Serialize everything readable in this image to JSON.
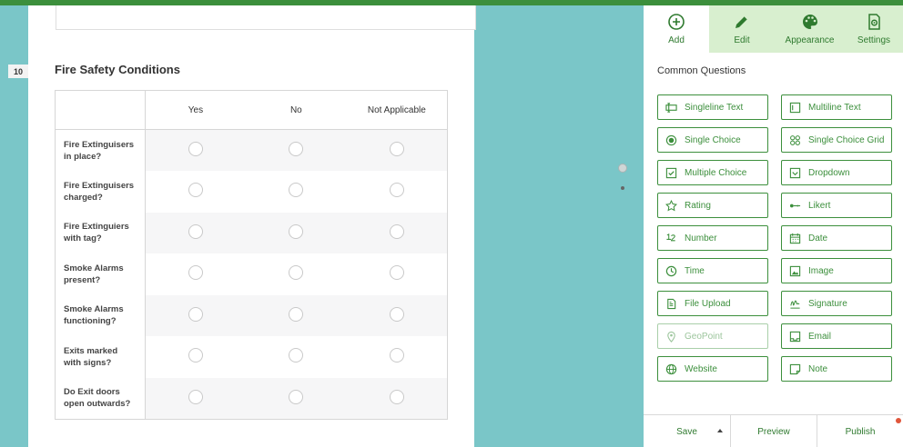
{
  "question": {
    "number": "10",
    "title": "Fire Safety Conditions",
    "columns": [
      "Yes",
      "No",
      "Not Applicable"
    ],
    "rows": [
      [
        "Fire Extinguisers",
        "in place?"
      ],
      [
        "Fire Extinguisers",
        "charged?"
      ],
      [
        "Fire Extinguiers",
        "with tag?"
      ],
      [
        "Smoke Alarms",
        "present?"
      ],
      [
        "Smoke Alarms",
        "functioning?"
      ],
      [
        "Exits marked",
        "with signs?"
      ],
      [
        "Do Exit doors",
        "open outwards?"
      ]
    ]
  },
  "panel": {
    "tabs": [
      "Add",
      "Edit",
      "Appearance",
      "Settings"
    ],
    "section_title": "Common Questions",
    "items": [
      {
        "label": "Singleline Text",
        "icon": "singleline-text-icon"
      },
      {
        "label": "Multiline Text",
        "icon": "multiline-text-icon"
      },
      {
        "label": "Single Choice",
        "icon": "radio-icon"
      },
      {
        "label": "Single Choice Grid",
        "icon": "grid-icon"
      },
      {
        "label": "Multiple Choice",
        "icon": "checkbox-icon"
      },
      {
        "label": "Dropdown",
        "icon": "dropdown-icon"
      },
      {
        "label": "Rating",
        "icon": "star-icon"
      },
      {
        "label": "Likert",
        "icon": "likert-icon"
      },
      {
        "label": "Number",
        "icon": "number-icon"
      },
      {
        "label": "Date",
        "icon": "calendar-icon"
      },
      {
        "label": "Time",
        "icon": "clock-icon"
      },
      {
        "label": "Image",
        "icon": "image-icon"
      },
      {
        "label": "File Upload",
        "icon": "file-upload-icon"
      },
      {
        "label": "Signature",
        "icon": "signature-icon"
      },
      {
        "label": "GeoPoint",
        "icon": "location-pin-icon"
      },
      {
        "label": "Email",
        "icon": "email-icon"
      },
      {
        "label": "Website",
        "icon": "globe-icon"
      },
      {
        "label": "Note",
        "icon": "note-icon"
      }
    ],
    "bottom": {
      "save": "Save",
      "preview": "Preview",
      "publish": "Publish"
    }
  },
  "colors": {
    "accent": "#3c8f3c",
    "tab_bg": "#d8efcf",
    "canvas_bg": "#7ac6c8"
  }
}
